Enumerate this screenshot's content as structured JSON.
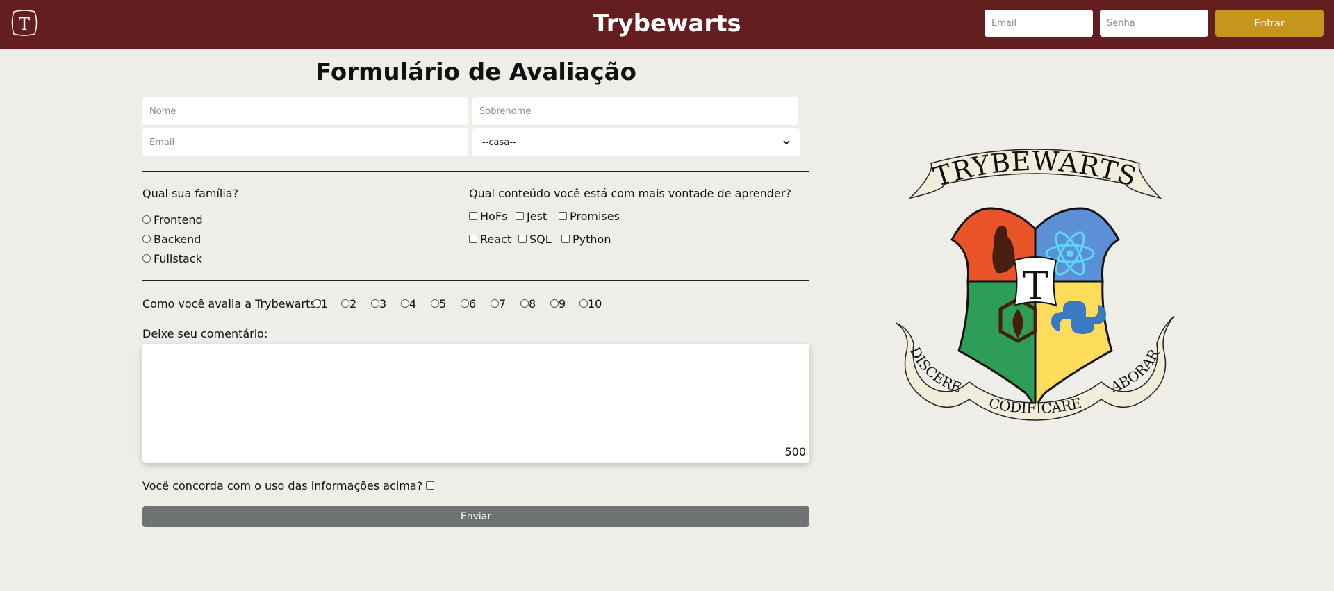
{
  "header": {
    "logo_letter": "T",
    "title": "Trybewarts",
    "email_placeholder": "Email",
    "password_placeholder": "Senha",
    "login_label": "Entrar"
  },
  "form": {
    "title": "Formulário de Avaliação",
    "first_name_placeholder": "Nome",
    "last_name_placeholder": "Sobrenome",
    "email_placeholder": "Email",
    "house_selected": "--casa--",
    "family_question": "Qual sua família?",
    "families": [
      "Frontend",
      "Backend",
      "Fullstack"
    ],
    "content_question": "Qual conteúdo você está com mais vontade de aprender?",
    "subjects": [
      "HoFs",
      "Jest",
      "Promises",
      "React",
      "SQL",
      "Python"
    ],
    "rating_question": "Como você avalia a Trybewarts?",
    "ratings": [
      "1",
      "2",
      "3",
      "4",
      "5",
      "6",
      "7",
      "8",
      "9",
      "10"
    ],
    "comment_label": "Deixe seu comentário:",
    "counter": "500",
    "agreement_label": "Você concorda com o uso das informações acima?",
    "submit_label": "Enviar"
  },
  "crest": {
    "banner_top": "TRYBEWARTS",
    "center_letter": "T",
    "motto_left": "DISCERE",
    "motto_bottom": "CODIFICARE",
    "motto_right": "LABORARE"
  },
  "colors": {
    "header_bg": "#641e1f",
    "page_bg": "#efede8",
    "login_button": "#c5961b",
    "submit_button": "#6f7273",
    "crest_red": "#e85427",
    "crest_blue": "#5b8fd6",
    "crest_green": "#2e9e57",
    "crest_yellow": "#fddc5c"
  }
}
